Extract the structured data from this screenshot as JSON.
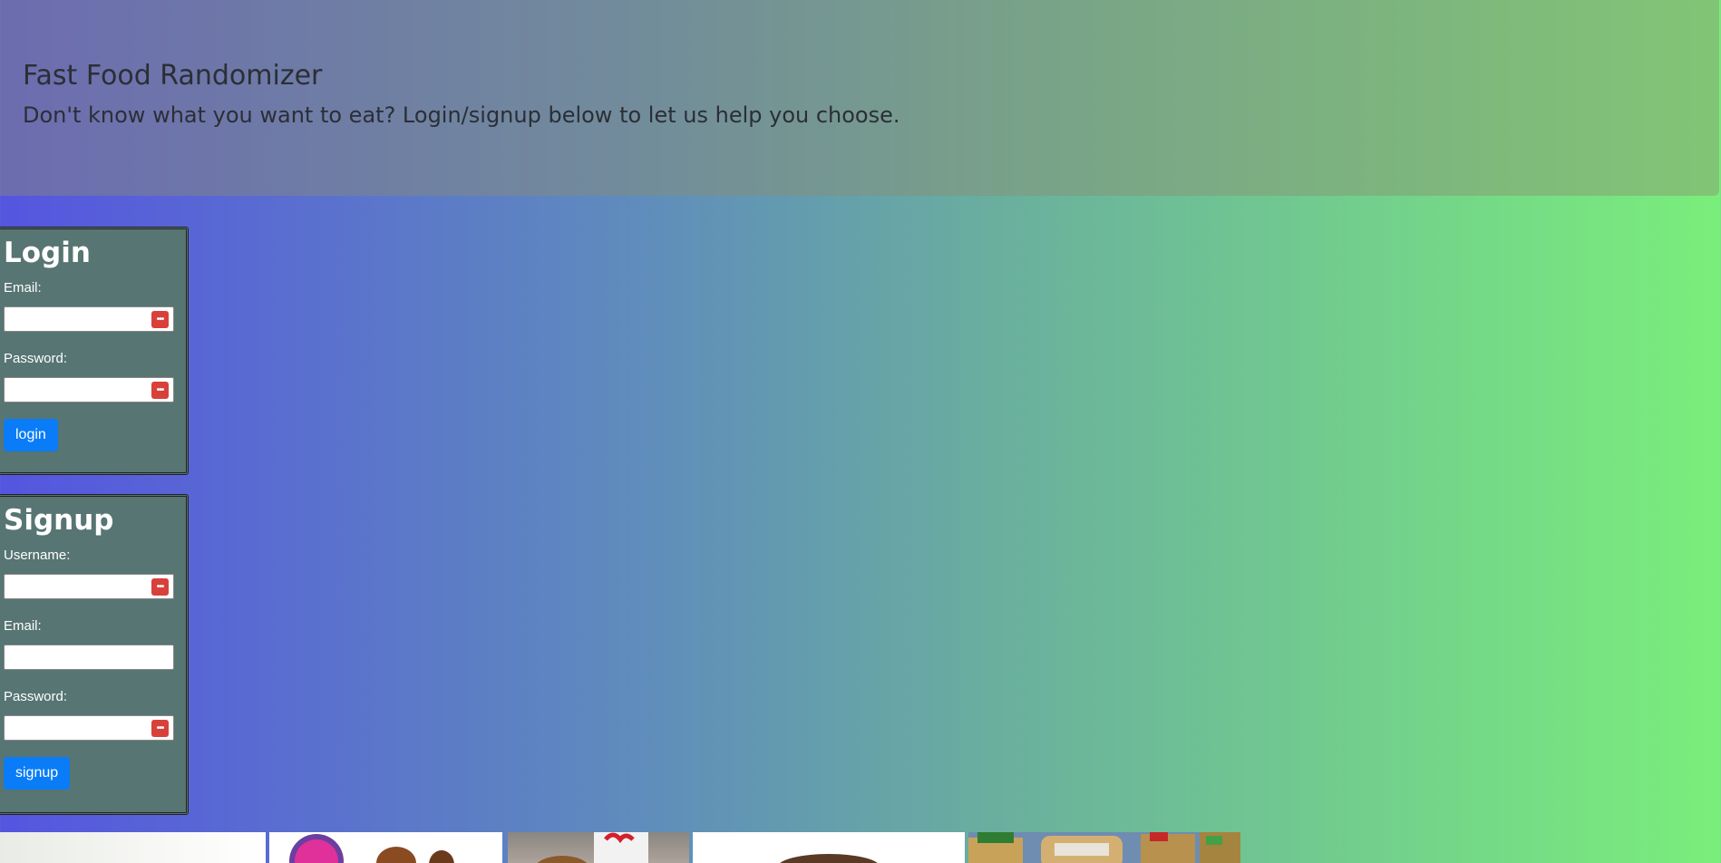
{
  "header": {
    "title": "Fast Food Randomizer",
    "subtitle": "Don't know what you want to eat? Login/signup below to let us help you choose."
  },
  "login": {
    "title": "Login",
    "email_label": "Email:",
    "password_label": "Password:",
    "button_label": "login",
    "email_value": "",
    "password_value": ""
  },
  "signup": {
    "title": "Signup",
    "username_label": "Username:",
    "email_label": "Email:",
    "password_label": "Password:",
    "button_label": "signup",
    "username_value": "",
    "email_value": "",
    "password_value": ""
  },
  "password_manager_icon": "password-manager-icon",
  "images": [
    {
      "name": "restaurant-image-1",
      "description": "light food photo"
    },
    {
      "name": "taco-bell-image",
      "description": "Taco Bell logo"
    },
    {
      "name": "chick-fil-a-image",
      "description": "Chick-fil-A cup"
    },
    {
      "name": "burger-image",
      "description": "burger"
    },
    {
      "name": "subway-image",
      "description": "sandwiches"
    }
  ],
  "colors": {
    "accent": "#0a7cf7",
    "card_bg": "#577572",
    "gradient_start": "#5555e0",
    "gradient_end": "#7aee7b",
    "pw_icon": "#d8413a"
  }
}
